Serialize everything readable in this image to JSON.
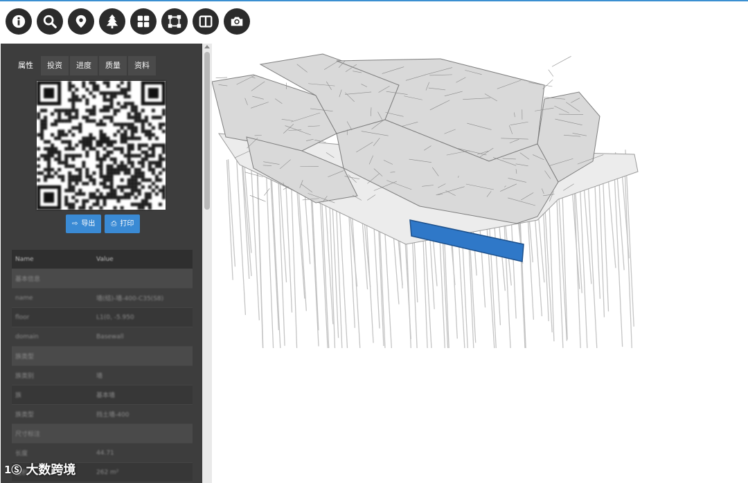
{
  "toolbar": {
    "icons": [
      "info-icon",
      "search-icon",
      "location-pin-icon",
      "tree-icon",
      "grid-layout-icon",
      "select-box-icon",
      "split-view-icon",
      "camera-icon"
    ]
  },
  "panel": {
    "tabs": [
      {
        "label": "属性"
      },
      {
        "label": "投资"
      },
      {
        "label": "进度"
      },
      {
        "label": "质量"
      },
      {
        "label": "资料"
      }
    ],
    "export_label": "导出",
    "print_label": "打印",
    "table": {
      "headers": {
        "name": "Name",
        "value": "Value"
      },
      "rows": [
        {
          "kind": "group",
          "name": "基本信息",
          "value": ""
        },
        {
          "kind": "row",
          "name": "name",
          "value": "墙(结)-墙-400-C35(S8)"
        },
        {
          "kind": "alt",
          "name": "floor",
          "value": "L1(0, -5.950"
        },
        {
          "kind": "row",
          "name": "domain",
          "value": "Basewall"
        },
        {
          "kind": "group",
          "name": "族类型",
          "value": ""
        },
        {
          "kind": "row",
          "name": "族类别",
          "value": "墙"
        },
        {
          "kind": "alt",
          "name": "族",
          "value": "基本墙"
        },
        {
          "kind": "row",
          "name": "族类型",
          "value": "挡土墙-400"
        },
        {
          "kind": "group",
          "name": "尺寸标注",
          "value": ""
        },
        {
          "kind": "row",
          "name": "长度",
          "value": "44.71"
        },
        {
          "kind": "alt",
          "name": "面积",
          "value": "262 m²"
        }
      ]
    }
  },
  "watermark": {
    "logo": "1Ⓢ",
    "text": "大数跨境"
  },
  "colors": {
    "accent": "#3a8ad4",
    "highlight": "#2f78c8",
    "toolbar": "#2b2b2b",
    "panel": "#3d3d3d"
  }
}
